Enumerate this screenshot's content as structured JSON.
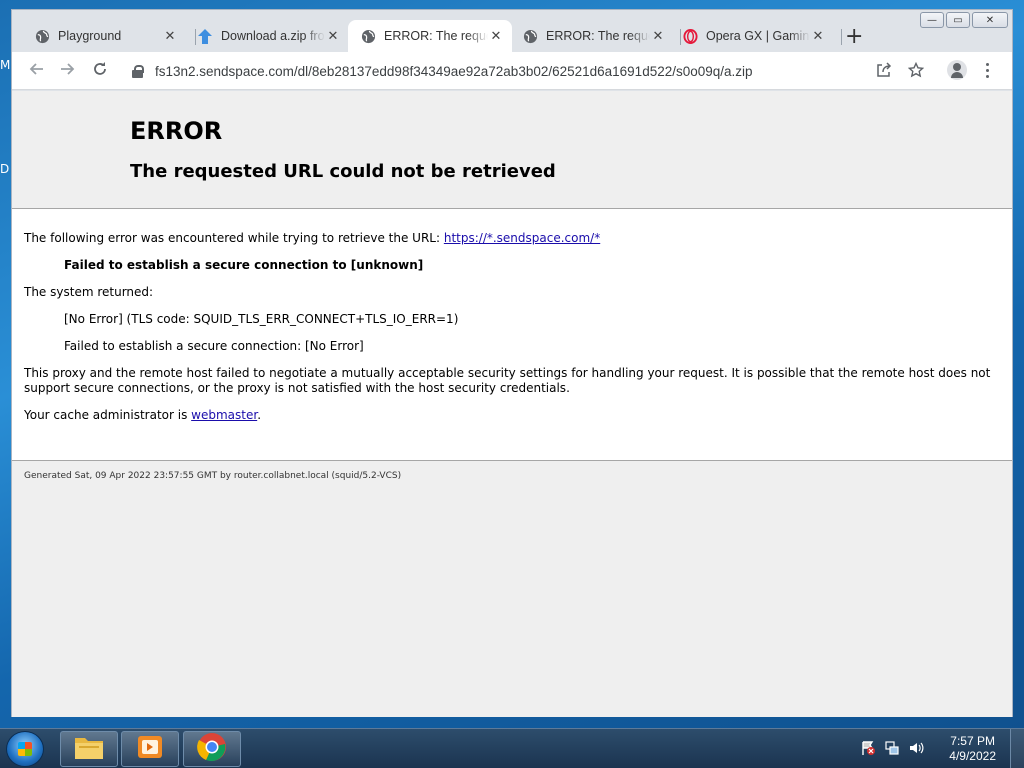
{
  "desktop": {
    "edge_letters": [
      "M",
      "D"
    ]
  },
  "browser": {
    "tabs": [
      {
        "label": "Playground",
        "icon": "globe-icon",
        "active": false
      },
      {
        "label": "Download a.zip from",
        "icon": "download-icon",
        "active": false
      },
      {
        "label": "ERROR: The requested",
        "icon": "globe-icon",
        "active": true
      },
      {
        "label": "ERROR: The requested",
        "icon": "globe-icon",
        "active": false
      },
      {
        "label": "Opera GX | Gaming",
        "icon": "opera-icon",
        "active": false
      }
    ],
    "url": "fs13n2.sendspace.com/dl/8eb28137edd98f34349ae92a72ab3b02/62521d6a1691d522/s0o09q/a.zip"
  },
  "page": {
    "title": "ERROR",
    "subtitle": "The requested URL could not be retrieved",
    "intro_text": "The following error was encountered while trying to retrieve the URL: ",
    "intro_link": "https://*.sendspace.com/*",
    "error_summary": "Failed to establish a secure connection to [unknown]",
    "system_returned": "The system returned:",
    "tls_code": "[No Error] (TLS code: SQUID_TLS_ERR_CONNECT+TLS_IO_ERR=1)",
    "secure_conn": "Failed to establish a secure connection: [No Error]",
    "explanation": "This proxy and the remote host failed to negotiate a mutually acceptable security settings for handling your request. It is possible that the remote host does not support secure connections, or the proxy is not satisfied with the host security credentials.",
    "admin_text": "Your cache administrator is ",
    "admin_link": "webmaster",
    "admin_suffix": ".",
    "footer": "Generated Sat, 09 Apr 2022 23:57:55 GMT by router.collabnet.local (squid/5.2-VCS)"
  },
  "taskbar": {
    "pinned": [
      "explorer-icon",
      "media-player-icon",
      "chrome-icon"
    ],
    "time": "7:57 PM",
    "date": "4/9/2022"
  }
}
